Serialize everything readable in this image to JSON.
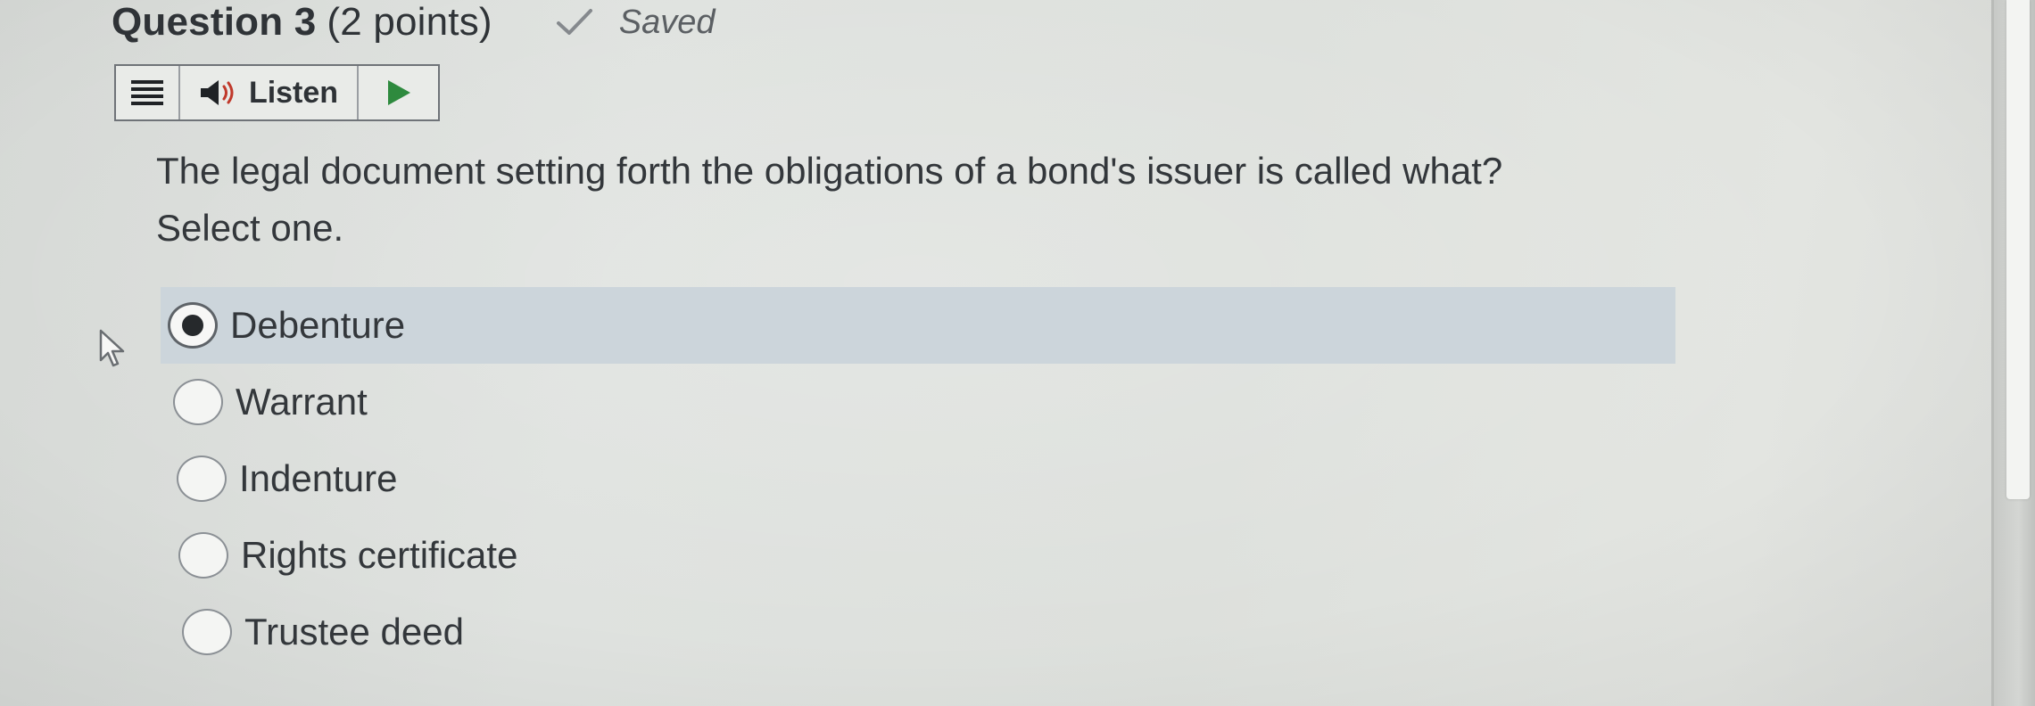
{
  "header": {
    "question_label": "Question 3",
    "points_label": "(2 points)",
    "status": "Saved"
  },
  "toolbar": {
    "listen_label": "Listen"
  },
  "question": {
    "text": "The legal document setting forth the obligations of a bond's issuer is called what?",
    "instruction": "Select one."
  },
  "options": [
    {
      "label": "Debenture",
      "selected": true
    },
    {
      "label": "Warrant",
      "selected": false
    },
    {
      "label": "Indenture",
      "selected": false
    },
    {
      "label": "Rights certificate",
      "selected": false
    },
    {
      "label": "Trustee deed",
      "selected": false
    }
  ],
  "colors": {
    "selected_row": "#ccd5db",
    "play_green": "#2e8a3e",
    "text": "#33373b"
  },
  "icons": {
    "menu": "hamburger-menu-icon",
    "speaker": "speaker-icon",
    "play": "play-icon",
    "check": "checkmark-icon",
    "cursor": "mouse-pointer-icon"
  }
}
